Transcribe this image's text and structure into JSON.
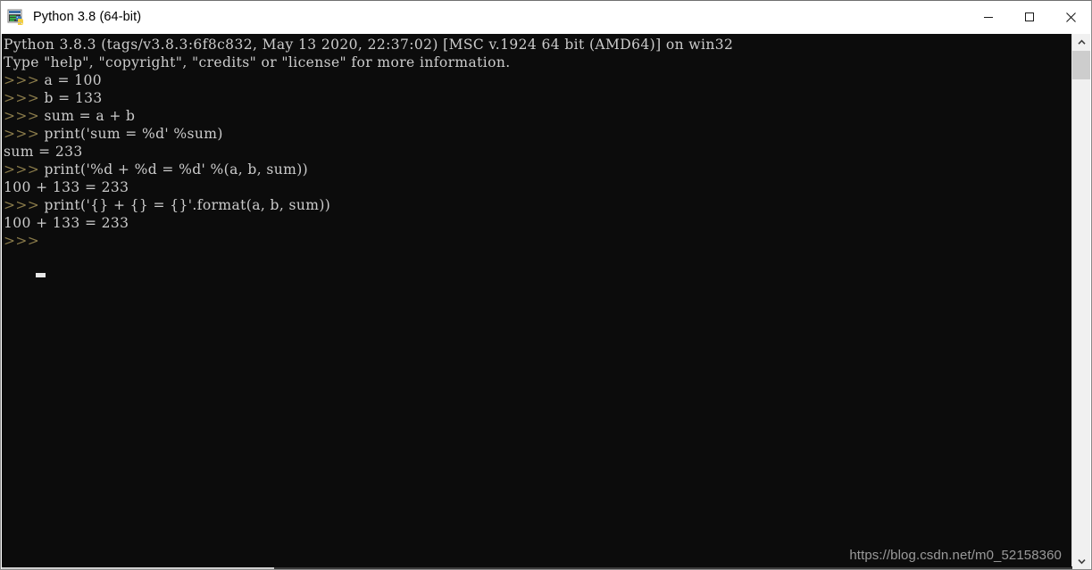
{
  "window": {
    "title": "Python 3.8 (64-bit)",
    "icon": "python-console-icon",
    "controls": {
      "minimize": "minimize-button",
      "maximize": "maximize-button",
      "close": "close-button"
    },
    "colors": {
      "titlebar_bg": "#ffffff",
      "console_bg": "#0c0c0c",
      "console_fg": "#cccccc",
      "prompt_fg": "#8a7b4a",
      "scrollbar_track": "#f0f0f0",
      "scrollbar_thumb": "#cdcdcd"
    }
  },
  "console": {
    "lines": [
      {
        "prompt": "",
        "text": "Python 3.8.3 (tags/v3.8.3:6f8c832, May 13 2020, 22:37:02) [MSC v.1924 64 bit (AMD64)] on win32"
      },
      {
        "prompt": "",
        "text": "Type \"help\", \"copyright\", \"credits\" or \"license\" for more information."
      },
      {
        "prompt": ">>>",
        "text": " a = 100"
      },
      {
        "prompt": ">>>",
        "text": " b = 133"
      },
      {
        "prompt": ">>>",
        "text": " sum = a + b"
      },
      {
        "prompt": ">>>",
        "text": " print('sum = %d' %sum)"
      },
      {
        "prompt": "",
        "text": "sum = 233"
      },
      {
        "prompt": ">>>",
        "text": " print('%d + %d = %d' %(a, b, sum))"
      },
      {
        "prompt": "",
        "text": "100 + 133 = 233"
      },
      {
        "prompt": ">>>",
        "text": " print('{} + {} = {}'.format(a, b, sum))"
      },
      {
        "prompt": "",
        "text": "100 + 133 = 233"
      },
      {
        "prompt": ">>>",
        "text": " "
      }
    ],
    "cursor": "block-cursor"
  },
  "watermark": {
    "text": "https://blog.csdn.net/m0_52158360"
  },
  "scrollbars": {
    "vertical": {
      "up_arrow": "scroll-up-arrow",
      "down_arrow": "scroll-down-arrow",
      "thumb": "vertical-scroll-thumb"
    },
    "horizontal": {
      "thumb": "horizontal-scroll-thumb"
    }
  }
}
